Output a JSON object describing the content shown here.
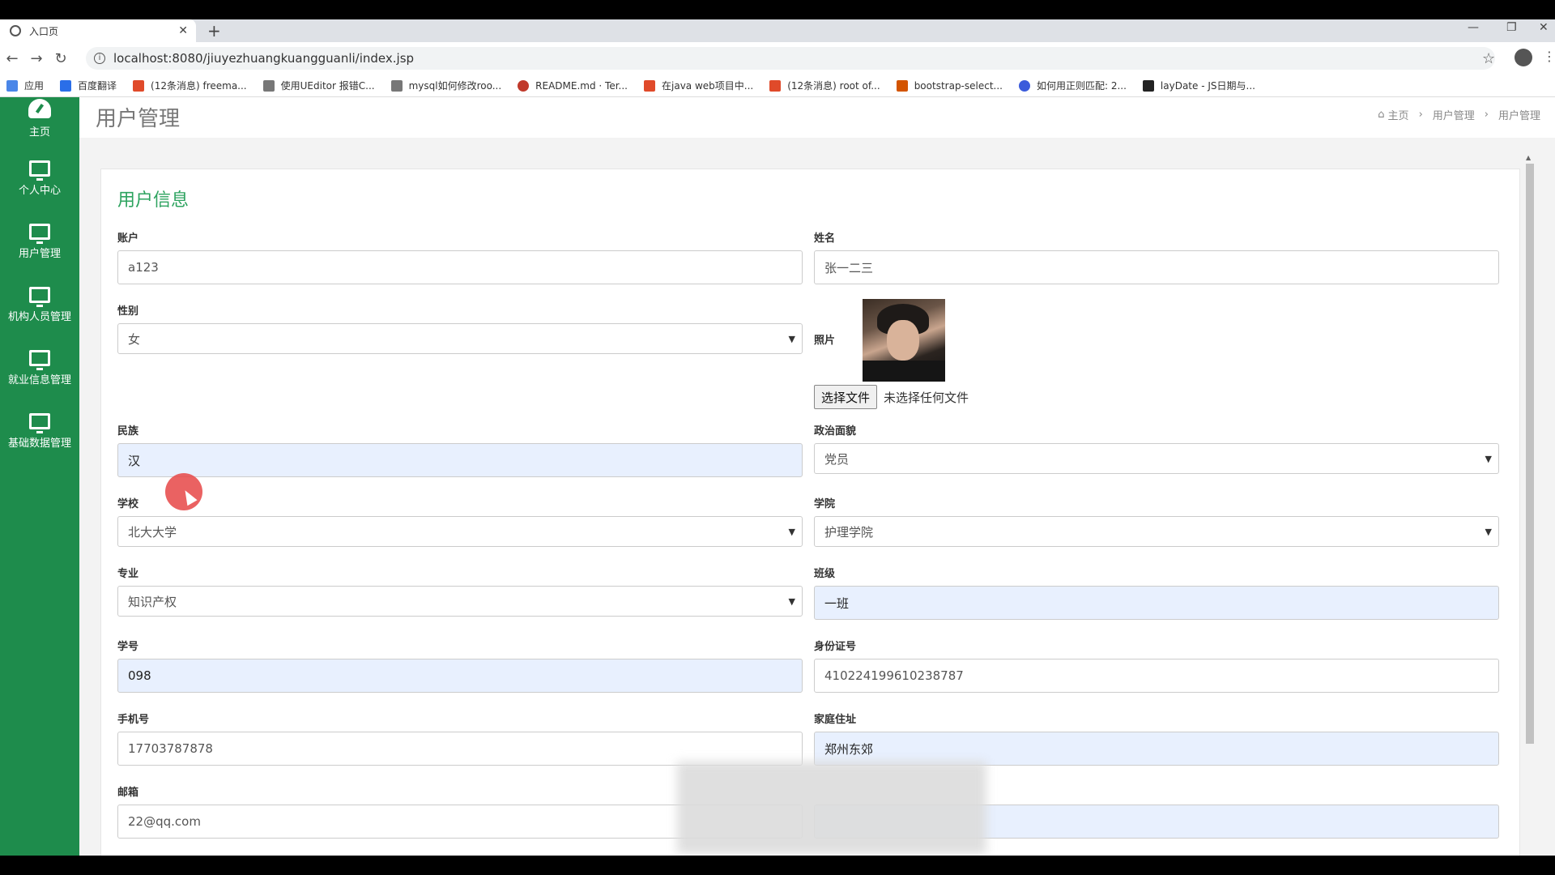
{
  "browser": {
    "tab_title": "入口页",
    "url": "localhost:8080/jiuyezhuangkuangguanli/index.jsp",
    "bookmarks": [
      "应用",
      "百度翻译",
      "(12条消息) freema...",
      "使用UEditor 报错C...",
      "mysql如何修改roo...",
      "README.md · Ter...",
      "在java web项目中...",
      "(12条消息) root of...",
      "bootstrap-select...",
      "如何用正则匹配: 2...",
      "layDate - JS日期与..."
    ]
  },
  "sidebar": {
    "items": [
      {
        "label": "主页",
        "icon": "dashboard-icon"
      },
      {
        "label": "个人中心",
        "icon": "monitor-icon"
      },
      {
        "label": "用户管理",
        "icon": "monitor-icon"
      },
      {
        "label": "机构人员管理",
        "icon": "monitor-icon"
      },
      {
        "label": "就业信息管理",
        "icon": "monitor-icon"
      },
      {
        "label": "基础数据管理",
        "icon": "monitor-icon"
      }
    ]
  },
  "page": {
    "title": "用户管理",
    "breadcrumb": [
      "主页",
      "用户管理",
      "用户管理"
    ]
  },
  "form": {
    "title": "用户信息",
    "account_label": "账户",
    "account_value": "a123",
    "name_label": "姓名",
    "name_value": "张一二三",
    "gender_label": "性别",
    "gender_value": "女",
    "photo_label": "照片",
    "file_button": "选择文件",
    "file_status": "未选择任何文件",
    "nation_label": "民族",
    "nation_value": "汉",
    "politics_label": "政治面貌",
    "politics_value": "党员",
    "school_label": "学校",
    "school_value": "北大大学",
    "college_label": "学院",
    "college_value": "护理学院",
    "major_label": "专业",
    "major_value": "知识产权",
    "class_label": "班级",
    "class_value": "一班",
    "student_no_label": "学号",
    "student_no_value": "098",
    "id_no_label": "身份证号",
    "id_no_value": "410224199610238787",
    "phone_label": "手机号",
    "phone_value": "17703787878",
    "address_label": "家庭住址",
    "address_value": "郑州东郊",
    "email_label": "邮箱",
    "email_value": "22@qq.com"
  },
  "colors": {
    "sidebar": "#1e8c4c",
    "accent_green": "#2da35f",
    "filled_input": "#e8f0fe"
  }
}
